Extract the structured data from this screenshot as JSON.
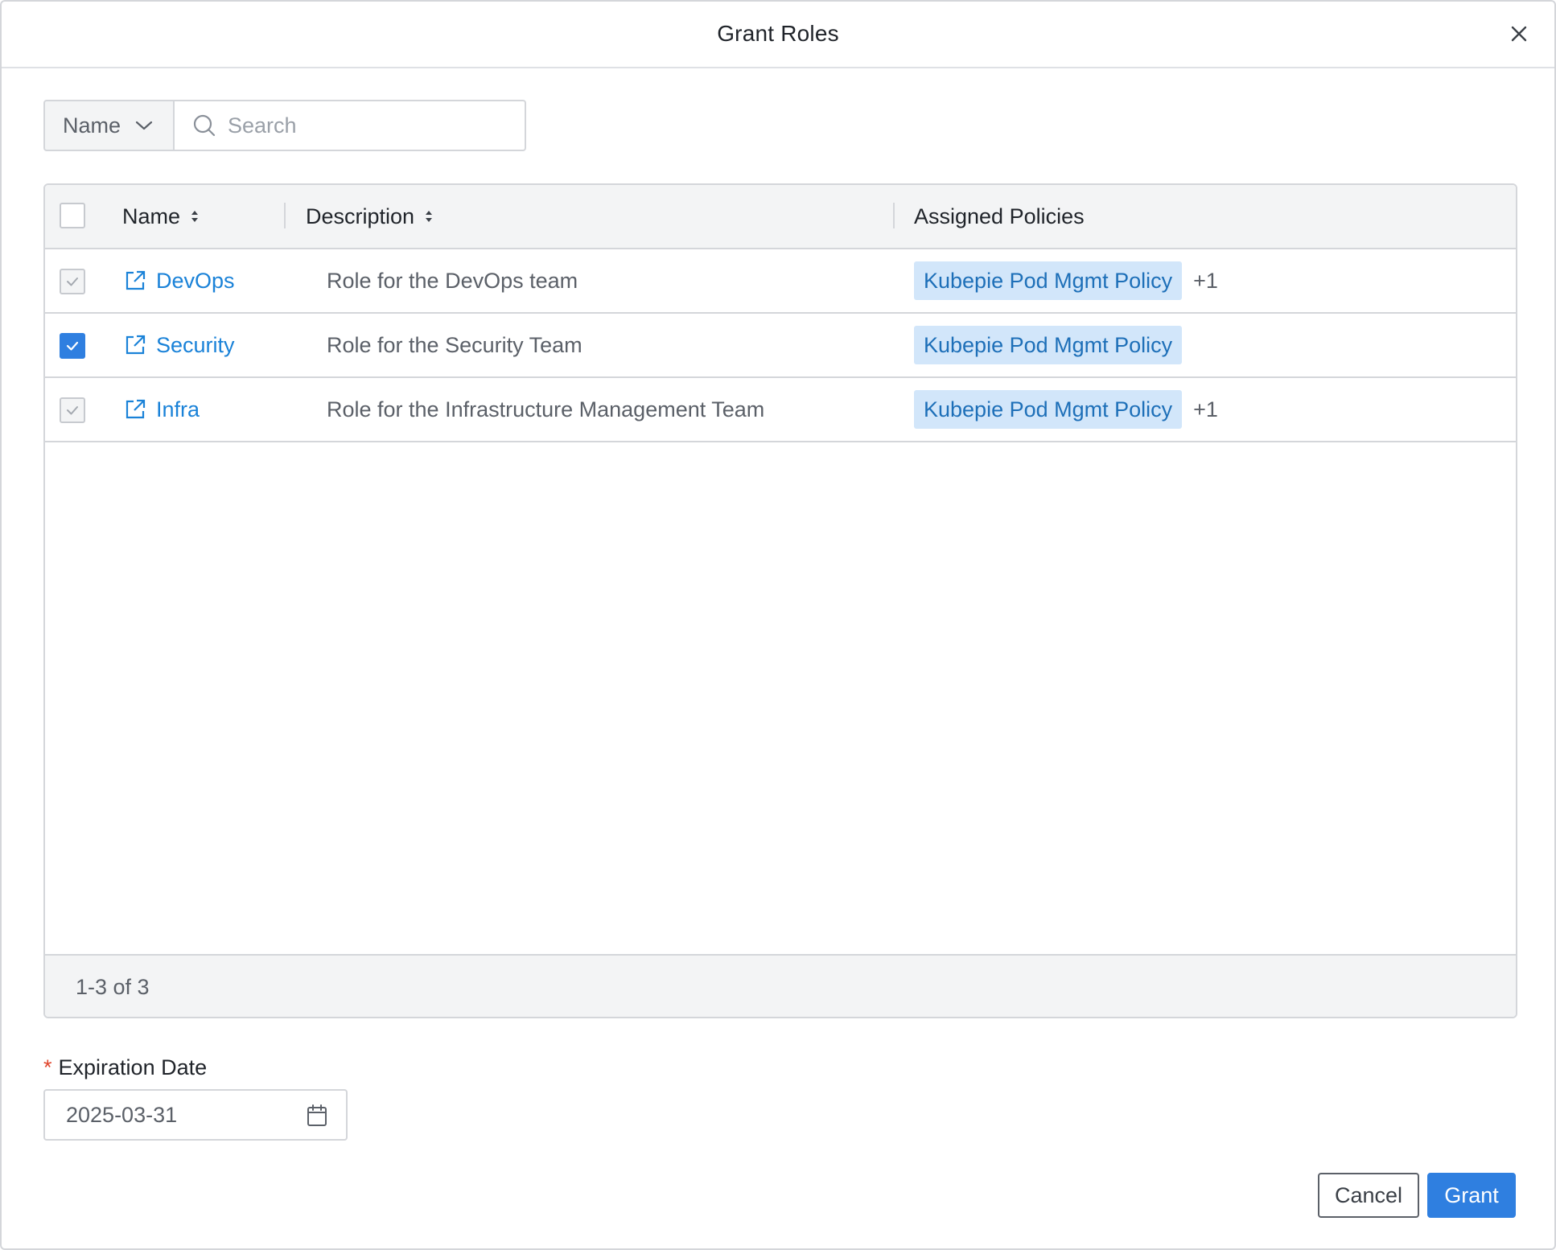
{
  "dialog": {
    "title": "Grant Roles"
  },
  "search": {
    "field": "Name",
    "placeholder": "Search"
  },
  "table": {
    "columns": {
      "name": "Name",
      "description": "Description",
      "policies": "Assigned Policies"
    },
    "rows": [
      {
        "name": "DevOps",
        "description": "Role for the DevOps team",
        "policy": "Kubepie Pod Mgmt Policy",
        "more": "+1",
        "state": "disabled-checked"
      },
      {
        "name": "Security",
        "description": "Role for the Security Team",
        "policy": "Kubepie Pod Mgmt Policy",
        "more": "",
        "state": "checked"
      },
      {
        "name": "Infra",
        "description": "Role for the Infrastructure Management Team",
        "policy": "Kubepie Pod Mgmt Policy",
        "more": "+1",
        "state": "disabled-checked"
      }
    ],
    "pager": "1-3 of 3"
  },
  "expiration": {
    "required_mark": "*",
    "label": "Expiration Date",
    "value": "2025-03-31"
  },
  "buttons": {
    "cancel": "Cancel",
    "grant": "Grant"
  },
  "colors": {
    "accent": "#2f7fe0",
    "link": "#1a82d8",
    "tag_bg": "#d2e6fa",
    "required": "#e0462d"
  },
  "icons": {
    "close": "close-icon",
    "dropdown": "chevron-down-icon",
    "search": "search-icon",
    "sort": "sort-icon",
    "external": "external-link-icon",
    "calendar": "calendar-icon",
    "check": "check-icon"
  }
}
